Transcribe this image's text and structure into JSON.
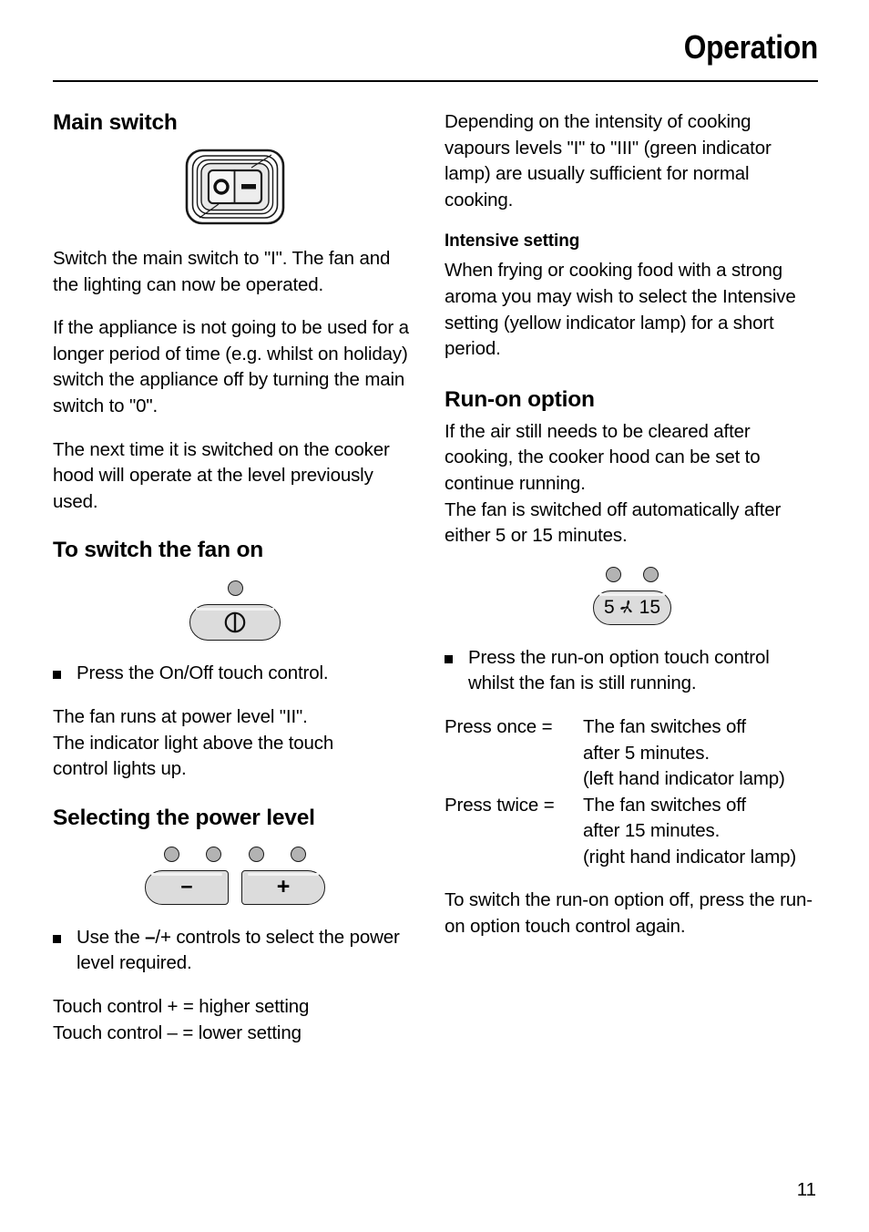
{
  "header": {
    "title": "Operation"
  },
  "left_column": {
    "main_switch": {
      "heading": "Main switch",
      "figure": {
        "name": "main-switch-rocker",
        "off_symbol": "o",
        "on_symbol": "—"
      },
      "paragraphs": [
        "Switch the main switch to \"I\". The fan and the lighting can now be operated.",
        "If the appliance is not going to be used for a longer period of time (e.g. whilst on holiday) switch the appliance off by turning the main switch to \"0\".",
        "The next time it is switched on the cooker hood will operate at the level previously used."
      ]
    },
    "switch_fan_on": {
      "heading": "To switch the fan on",
      "figure": {
        "name": "on-off-touch-control",
        "lamp_count": 1,
        "button_symbol": "power-symbol"
      },
      "bullet": "Press the On/Off touch control.",
      "paragraph": "The fan runs at power level \"II\".\nThe indicator light above the touch control lights up.",
      "paragraph_line1": "The fan runs at power level \"II\".",
      "paragraph_line2": "The indicator light above the touch",
      "paragraph_line3": "control lights up."
    },
    "power_level": {
      "heading": "Selecting the power level",
      "figure": {
        "name": "minus-plus-touch-controls",
        "lamp_count": 4,
        "minus_label": "−",
        "plus_label": "+"
      },
      "bullet_part1": "Use the ",
      "bullet_symbol": "–",
      "bullet_part2": "/+ controls to select the power level required.",
      "rows": [
        {
          "control": "Touch control +",
          "equals": "=",
          "result": "higher setting"
        },
        {
          "control": "Touch control –",
          "equals": "=",
          "result": "lower setting"
        }
      ],
      "row1_text": "Touch control +  = higher setting",
      "row2_text": "Touch control –  = lower setting"
    }
  },
  "right_column": {
    "intro_paragraph": "Depending on the intensity of cooking vapours levels \"I\" to \"III\" (green indicator lamp) are usually sufficient for normal cooking.",
    "intensive_setting": {
      "heading": "Intensive setting",
      "paragraph": "When frying or cooking food with a strong aroma you may wish to select the Intensive setting (yellow indicator lamp) for a short period."
    },
    "run_on_option": {
      "heading": "Run-on option",
      "paragraph1": "If the air still needs to be cleared after cooking, the cooker hood can be set to continue running.",
      "paragraph2": "The fan is switched off automatically after either 5 or 15 minutes.",
      "figure": {
        "name": "run-on-touch-control",
        "lamp_count": 2,
        "left_label": "5",
        "fan_icon": "fan-blades-icon",
        "right_label": "15"
      },
      "bullet": "Press the run-on option touch control whilst the fan is still running.",
      "definitions": [
        {
          "term": "Press once =",
          "lines": [
            "The fan switches off",
            "after 5 minutes.",
            "(left hand indicator lamp)"
          ]
        },
        {
          "term": "Press twice =",
          "lines": [
            "The fan switches off",
            "after 15 minutes.",
            "(right hand indicator lamp)"
          ]
        }
      ],
      "closing_paragraph": "To switch the run-on option off, press the run-on option touch control again."
    }
  },
  "footer": {
    "page_number": "11"
  },
  "colors": {
    "text": "#000000",
    "lamp_fill": "#b3b3b3",
    "button_fill": "#dcdcdc",
    "outline": "#1a1a1a"
  }
}
